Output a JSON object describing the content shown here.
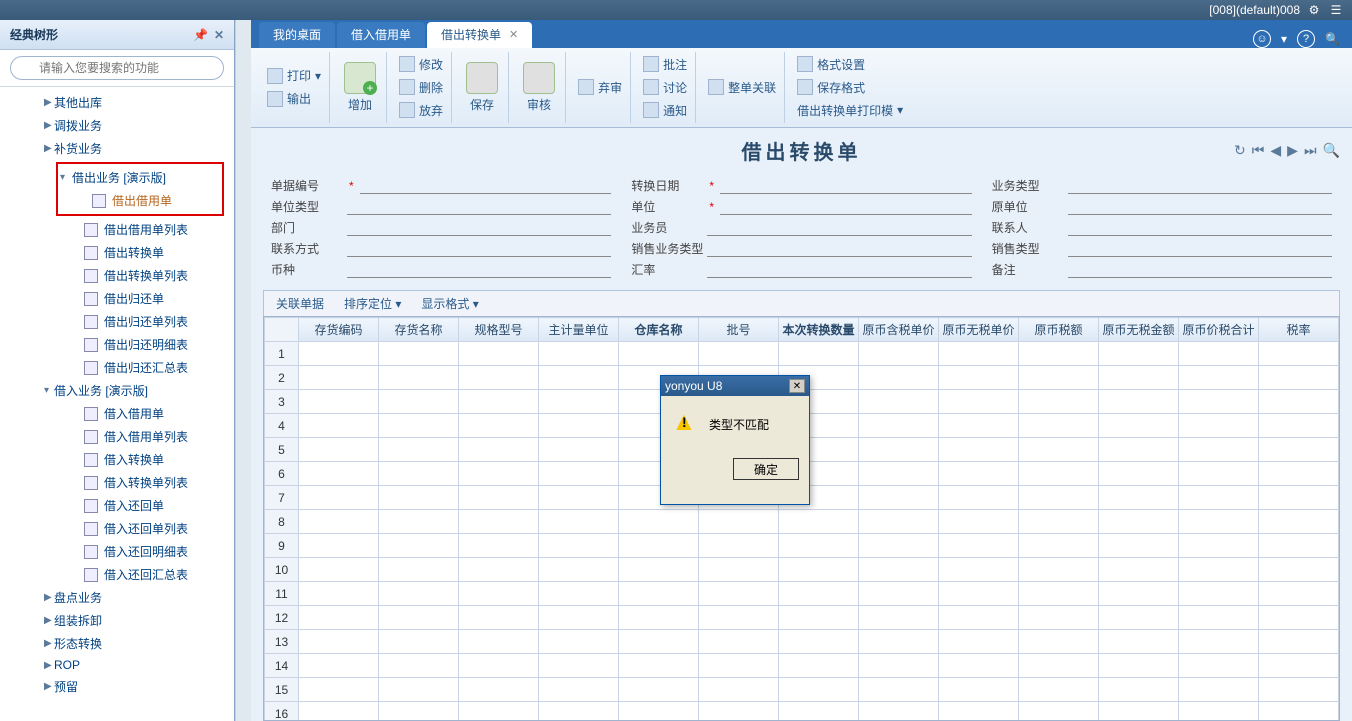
{
  "titlebar": {
    "user_text": "[008](default)008"
  },
  "sidebar": {
    "title": "经典树形",
    "search_placeholder": "请输入您要搜索的功能",
    "items": [
      {
        "label": "其他出库",
        "level": 1,
        "arrow": "▶"
      },
      {
        "label": "调拨业务",
        "level": 1,
        "arrow": "▶"
      },
      {
        "label": "补货业务",
        "level": 1,
        "arrow": "▶"
      }
    ],
    "highlighted_group": {
      "parent": "借出业务 [演示版]",
      "child": "借出借用单"
    },
    "items2": [
      {
        "label": "借出借用单列表",
        "level": 2
      },
      {
        "label": "借出转换单",
        "level": 2
      },
      {
        "label": "借出转换单列表",
        "level": 2
      },
      {
        "label": "借出归还单",
        "level": 2
      },
      {
        "label": "借出归还单列表",
        "level": 2
      },
      {
        "label": "借出归还明细表",
        "level": 2
      },
      {
        "label": "借出归还汇总表",
        "level": 2
      }
    ],
    "items3_parent": "借入业务 [演示版]",
    "items3": [
      {
        "label": "借入借用单",
        "level": 2
      },
      {
        "label": "借入借用单列表",
        "level": 2
      },
      {
        "label": "借入转换单",
        "level": 2
      },
      {
        "label": "借入转换单列表",
        "level": 2
      },
      {
        "label": "借入还回单",
        "level": 2
      },
      {
        "label": "借入还回单列表",
        "level": 2
      },
      {
        "label": "借入还回明细表",
        "level": 2
      },
      {
        "label": "借入还回汇总表",
        "level": 2
      }
    ],
    "items4": [
      {
        "label": "盘点业务",
        "level": 1,
        "arrow": "▶"
      },
      {
        "label": "组装拆卸",
        "level": 1,
        "arrow": "▶"
      },
      {
        "label": "形态转换",
        "level": 1,
        "arrow": "▶"
      },
      {
        "label": "ROP",
        "level": 1,
        "arrow": "▶"
      },
      {
        "label": "预留",
        "level": 1,
        "arrow": "▶"
      }
    ]
  },
  "tabs": {
    "items": [
      {
        "label": "我的桌面",
        "active": false
      },
      {
        "label": "借入借用单",
        "active": false
      },
      {
        "label": "借出转换单",
        "active": true
      }
    ]
  },
  "ribbon": {
    "print": "打印",
    "output": "输出",
    "add": "增加",
    "modify": "修改",
    "delete": "删除",
    "discard": "放弃",
    "save": "保存",
    "audit": "审核",
    "abandon": "弃审",
    "remark": "批注",
    "discuss": "讨论",
    "notify": "通知",
    "whole_link": "整单关联",
    "format_set": "格式设置",
    "save_format": "保存格式",
    "print_template": "借出转换单打印模"
  },
  "doc_title": "借出转换单",
  "form": {
    "f1": "单据编号",
    "f2": "转换日期",
    "f3": "业务类型",
    "f4": "单位类型",
    "f5": "单位",
    "f6": "原单位",
    "f7": "部门",
    "f8": "业务员",
    "f9": "联系人",
    "f10": "联系方式",
    "f11": "销售业务类型",
    "f12": "销售类型",
    "f13": "币种",
    "f14": "汇率",
    "f15": "备注"
  },
  "grid_toolbar": {
    "link": "关联单据",
    "sort": "排序定位",
    "format": "显示格式"
  },
  "grid": {
    "columns": [
      "",
      "存货编码",
      "存货名称",
      "规格型号",
      "主计量单位",
      "仓库名称",
      "批号",
      "本次转换数量",
      "原币含税单价",
      "原币无税单价",
      "原币税额",
      "原币无税金额",
      "原币价税合计",
      "税率"
    ],
    "bold_cols": [
      5,
      7
    ],
    "row_count": 16
  },
  "dialog": {
    "title": "yonyou U8",
    "message": "类型不匹配",
    "ok": "确定"
  }
}
